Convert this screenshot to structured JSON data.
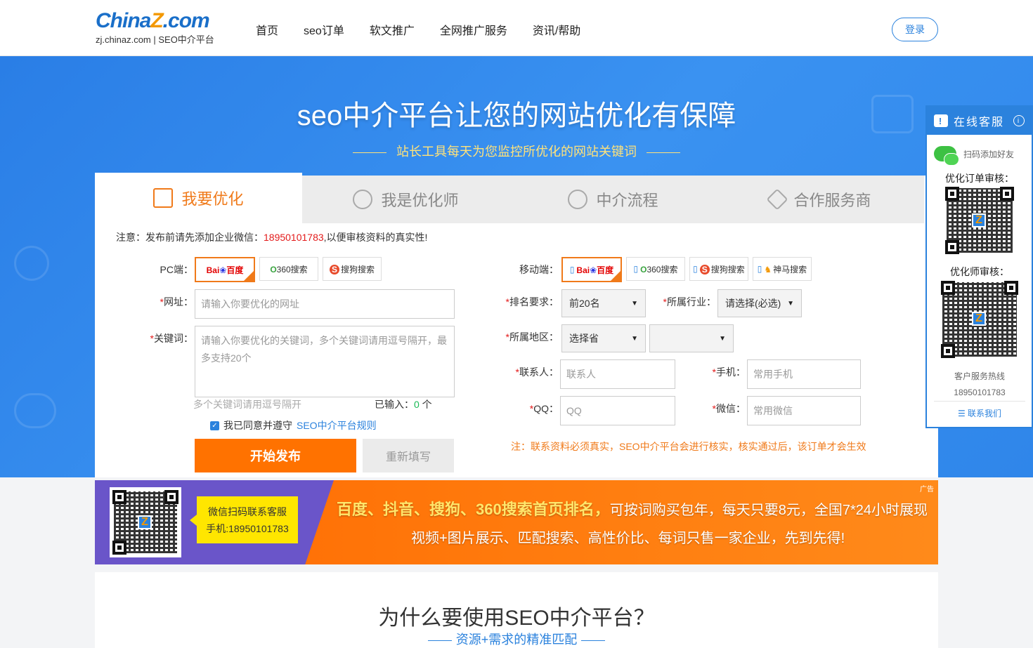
{
  "header": {
    "logo_main_a": "China",
    "logo_main_z": "Z",
    "logo_main_b": ".com",
    "logo_sub": "zj.chinaz.com | SEO中介平台",
    "nav": [
      "首页",
      "seo订单",
      "软文推广",
      "全网推广服务",
      "资讯/帮助"
    ],
    "login": "登录"
  },
  "hero": {
    "title": "seo中介平台让您的网站优化有保障",
    "subtitle": "站长工具每天为您监控所优化的网站关键词"
  },
  "tabs": [
    "我要优化",
    "我是优化师",
    "中介流程",
    "合作服务商"
  ],
  "notice": {
    "prefix": "注意：发布前请先添加企业微信：",
    "phone": "18950101783",
    "suffix": ",以便审核资料的真实性!"
  },
  "form": {
    "pc_label": "PC端：",
    "mobile_label": "移动端：",
    "engines_pc": [
      "Bai百度",
      "360搜索",
      "搜狗搜索"
    ],
    "engines_mobile": [
      "Bai百度",
      "360搜索",
      "搜狗搜索",
      "神马搜索"
    ],
    "url_label": "网址：",
    "url_placeholder": "请输入你要优化的网址",
    "kw_label": "关键词：",
    "kw_placeholder": "请输入你要优化的关键词，多个关键词请用逗号隔开，最多支持20个",
    "kw_hint": "多个关键词请用逗号隔开",
    "count_prefix": "已输入：",
    "count_value": "0",
    "count_suffix": " 个",
    "agree_text": "我已同意并遵守",
    "agree_link": "SEO中介平台规则",
    "publish": "开始发布",
    "reset": "重新填写",
    "rank_label": "排名要求：",
    "rank_value": "前20名",
    "industry_label": "所属行业：",
    "industry_value": "请选择(必选)",
    "region_label": "所属地区：",
    "province_value": "选择省",
    "city_value": "",
    "contact_label": "联系人：",
    "contact_placeholder": "联系人",
    "phone_label": "手机：",
    "phone_placeholder": "常用手机",
    "qq_label": "QQ：",
    "qq_placeholder": "QQ",
    "wechat_label": "微信：",
    "wechat_placeholder": "常用微信",
    "bottom_note": "注：联系资料必须真实，SEO中介平台会进行核实，核实通过后，该订单才会生效"
  },
  "ad": {
    "tag": "广告",
    "kf_line1": "微信扫码联系客服",
    "kf_line2": "手机:18950101783",
    "line1_bold": "百度、抖音、搜狗、360搜索首页排名，",
    "line1_rest": "可按词购买包年，每天只要8元，全国7*24小时展现",
    "line2": "视频+图片展示、匹配搜索、高性价比、每词只售一家企业，先到先得!"
  },
  "why": {
    "title": "为什么要使用SEO中介平台？",
    "subtitle": "资源+需求的精准匹配"
  },
  "side": {
    "title": "在线客服",
    "wx": "扫码添加好友",
    "order_review": "优化订单审核：",
    "optimizer_review": "优化师审核：",
    "hotline_label": "客户服务热线",
    "hotline": "18950101783",
    "contact": "联系我们"
  },
  "colors": {
    "brand_blue": "#2b82dd",
    "accent_orange": "#ff7200",
    "notice_red": "#e31b1b"
  }
}
